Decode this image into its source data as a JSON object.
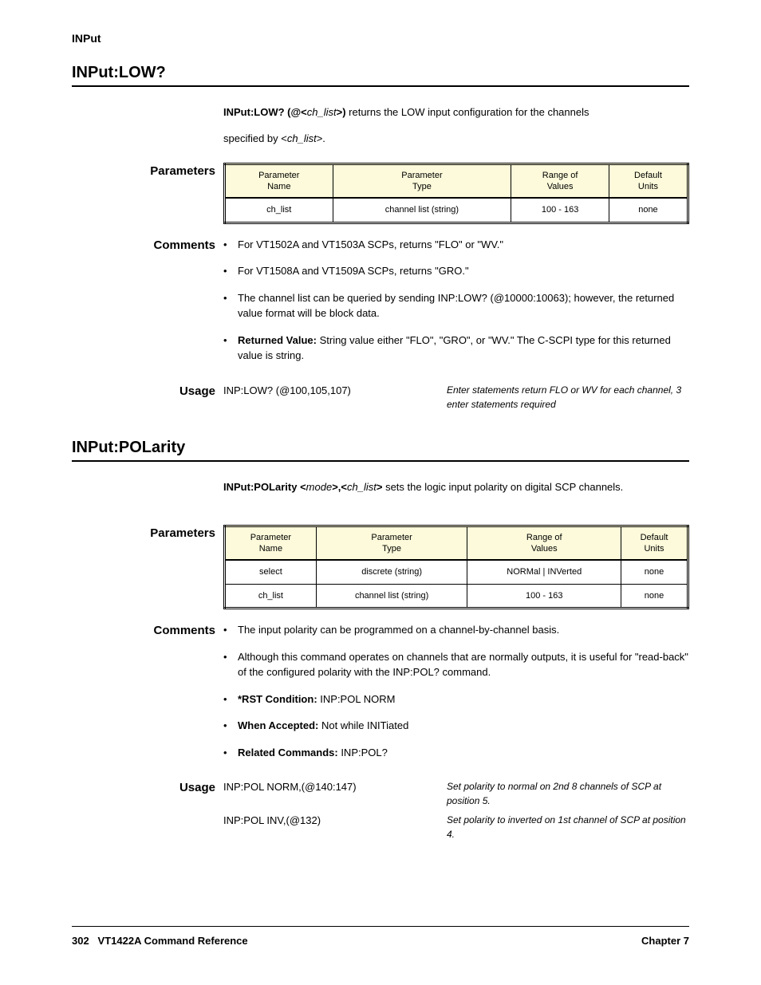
{
  "header_tag": "INPut",
  "section1": {
    "title": "INPut:LOW?",
    "syntax_prefix": "INPut:LOW? (@<",
    "syntax_param": "ch_list",
    "syntax_suffix": ">)",
    "desc_part1": " returns the LOW input configuration for the channels",
    "desc_part2": "specified by <",
    "desc_param": "ch_list",
    "desc_part3": ">.",
    "parameters_label": "Parameters",
    "table_headers": [
      "Parameter\nName",
      "Parameter\nType",
      "Range of\nValues",
      "Default\nUnits"
    ],
    "table_row": [
      "ch_list",
      "channel list (string)",
      "100 - 163",
      "none"
    ],
    "comments_label": "Comments",
    "bullets": [
      "For VT1502A and VT1503A SCPs, returns \"FLO\" or \"WV.\"",
      "For VT1508A and VT1509A SCPs, returns \"GRO.\"",
      "The channel list can be queried by sending INP:LOW? (@10000:10063); however, the returned value format will be block data.",
      "Returned Value: String value either \"FLO\", \"GRO\", or \"WV.\" The C-SCPI type for this returned value is string."
    ],
    "usage_label": "Usage",
    "usage_cmd": "INP:LOW? (@100,105,107)",
    "usage_desc": "Enter statements return FLO or WV for each channel, 3 enter statements required"
  },
  "section2": {
    "title": "INPut:POLarity",
    "syntax_prefix": "INPut:POLarity <",
    "syntax_p1": "mode",
    "syntax_mid": ">,<",
    "syntax_p2": "ch_list",
    "syntax_suffix": ">",
    "desc": " sets the logic input polarity on digital SCP channels.",
    "parameters_label": "Parameters",
    "table_headers": [
      "Parameter\nName",
      "Parameter\nType",
      "Range of\nValues",
      "Default\nUnits"
    ],
    "table_rows": [
      [
        "select",
        "discrete (string)",
        "NORMal | INVerted",
        "none"
      ],
      [
        "ch_list",
        "channel list (string)",
        "100 - 163",
        "none"
      ]
    ],
    "comments_label": "Comments",
    "bullets": [
      "The input polarity can be programmed on a channel-by-channel basis.",
      "Although this command operates on channels that are normally outputs, it is useful for \"read-back\" of the configured polarity with the INP:POL? command.",
      "*RST Condition: INP:POL NORM",
      "When Accepted: Not while INITiated",
      "Related Commands: INP:POL?"
    ],
    "usage_label": "Usage",
    "usage_rows": [
      {
        "cmd": "INP:POL NORM,(@140:147)",
        "desc": "Set polarity to normal on 2nd 8 channels of SCP at position 5."
      },
      {
        "cmd": "INP:POL INV,(@132)",
        "desc": "Set polarity to inverted on 1st channel of SCP at position 4."
      }
    ]
  },
  "footer": {
    "page": "302",
    "left": "VT1422A Command Reference",
    "right": "Chapter 7"
  }
}
